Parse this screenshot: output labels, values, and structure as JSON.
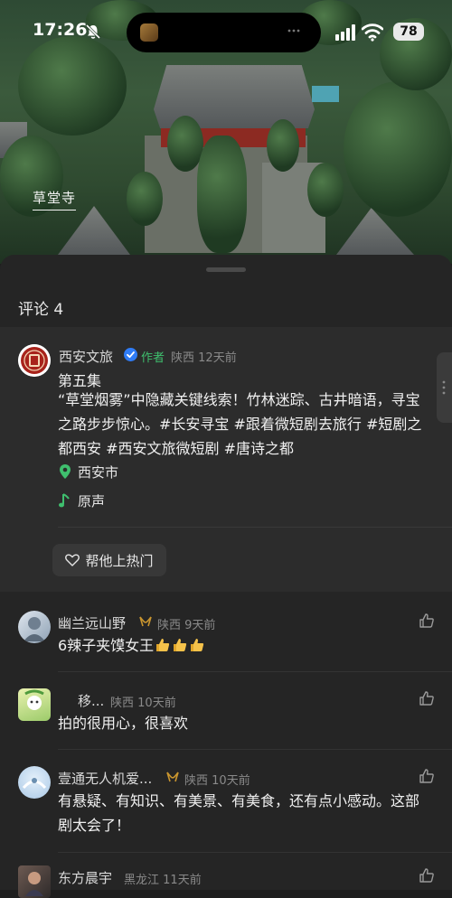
{
  "status_bar": {
    "time": "17:26",
    "battery": "78"
  },
  "photo": {
    "place_mark": "草堂寺"
  },
  "comments_panel": {
    "title": "评论 4",
    "original_post": {
      "author": "西安文旅",
      "author_tag": "作者",
      "region": "陕西",
      "age": "12天前",
      "episode": "第五集",
      "text": "“草堂烟雾”中隐藏关键线索！竹林迷踪、古井暗语，寻宝之路步步惊心。#长安寻宝 #跟着微短剧去旅行 #短剧之都西安 #西安文旅微短剧 #唐诗之都",
      "location": "西安市",
      "music": "原声",
      "hot_button": "帮他上热门"
    },
    "comments": [
      {
        "user": "幽兰远山野",
        "region": "陕西",
        "age": "9天前",
        "text": "6辣子夹馍女王"
      },
      {
        "user": "移...",
        "region": "陕西",
        "age": "10天前",
        "text": "拍的很用心，很喜欢"
      },
      {
        "user": "壹通无人机爱...",
        "region": "陕西",
        "age": "10天前",
        "text": "有悬疑、有知识、有美景、有美食，还有点小感动。这部剧太会了！"
      },
      {
        "user": "东方晨宇",
        "region": "黑龙江",
        "age": "11天前",
        "text": ""
      }
    ]
  },
  "colors": {
    "author_tag": "#3fbf6e",
    "verified": "#2f7cf6",
    "sheet": "#252525",
    "post_bg": "#2c2c2c"
  },
  "icons": [
    "bell-muted-icon",
    "signal-icon",
    "wifi-icon",
    "verified-icon",
    "location-pin-icon",
    "music-note-icon",
    "heart-outline-icon",
    "thumbs-up-icon",
    "ribbon-badge-icon"
  ]
}
